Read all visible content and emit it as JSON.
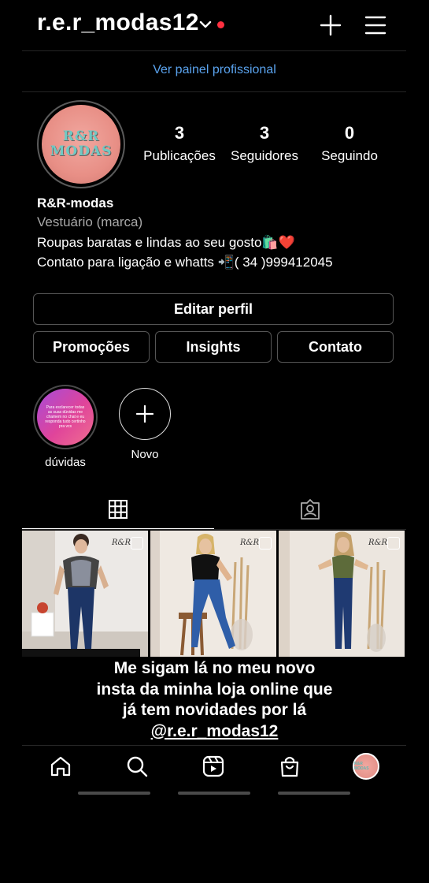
{
  "header": {
    "username": "r.e.r_modas12"
  },
  "professional_panel": "Ver painel profissional",
  "profile": {
    "avatar_text": [
      "R&R",
      "MODAS"
    ],
    "stats": [
      {
        "num": "3",
        "label": "Publicações"
      },
      {
        "num": "3",
        "label": "Seguidores"
      },
      {
        "num": "0",
        "label": "Seguindo"
      }
    ],
    "name": "R&R-modas",
    "category": "Vestuário (marca)",
    "bio_line1": "Roupas baratas e lindas ao seu gosto🛍️❤️",
    "bio_line2": "Contato para ligação e whatts  📲( 34 )999412045"
  },
  "buttons": {
    "edit_profile": "Editar perfil",
    "promotions": "Promoções",
    "insights": "Insights",
    "contact": "Contato"
  },
  "highlights": [
    {
      "label": "dúvidas",
      "cover_text": "Para esclarecer todas as suas dúvidas me chamem no chat e eu responda tudo certinho pra vcs"
    },
    {
      "label": "Novo"
    }
  ],
  "posts_watermark": "R&R",
  "caption": {
    "line1": "Me sigam lá no meu novo",
    "line2": "insta da minha loja online que",
    "line3": "já tem novidades por lá",
    "handle": "@r.e.r_modas12"
  },
  "nav_avatar_text": "R&R MODAS",
  "colors": {
    "background": "#000000",
    "link_blue": "#5aa3ee",
    "notification_dot": "#ff3040",
    "avatar_pink": "#e88f86",
    "logo_teal": "#6fc9c4"
  },
  "icons": [
    "chevron-down-icon",
    "plus-icon",
    "hamburger-menu-icon",
    "grid-icon",
    "tagged-icon",
    "home-icon",
    "search-icon",
    "reels-icon",
    "shop-icon",
    "multi-post-icon"
  ]
}
